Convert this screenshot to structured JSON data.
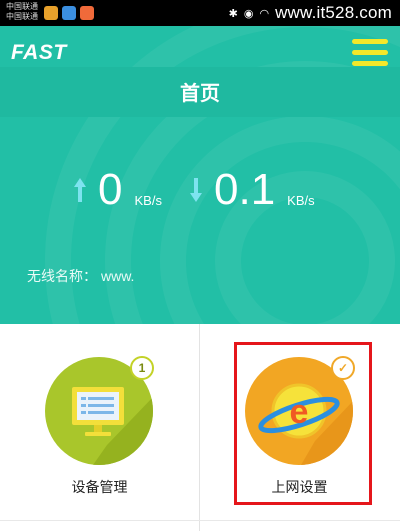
{
  "status_bar": {
    "carrier_1": "中国联通",
    "carrier_2": "中国联通",
    "watermark": "www.it528.com"
  },
  "header": {
    "logo": "FAST",
    "title": "首页"
  },
  "speeds": {
    "upload_value": "0",
    "upload_unit": "KB/s",
    "download_value": "0.1",
    "download_unit": "KB/s"
  },
  "wifi": {
    "label": "无线名称：",
    "value": "www."
  },
  "cards": [
    {
      "label": "设备管理",
      "badge": "1"
    },
    {
      "label": "上网设置"
    }
  ],
  "colors": {
    "teal": "#22bfa6",
    "menu_yellow": "#f3e82a",
    "device_green": "#a9c62b",
    "internet_orange": "#f2a623",
    "highlight_red": "#e5161b"
  }
}
